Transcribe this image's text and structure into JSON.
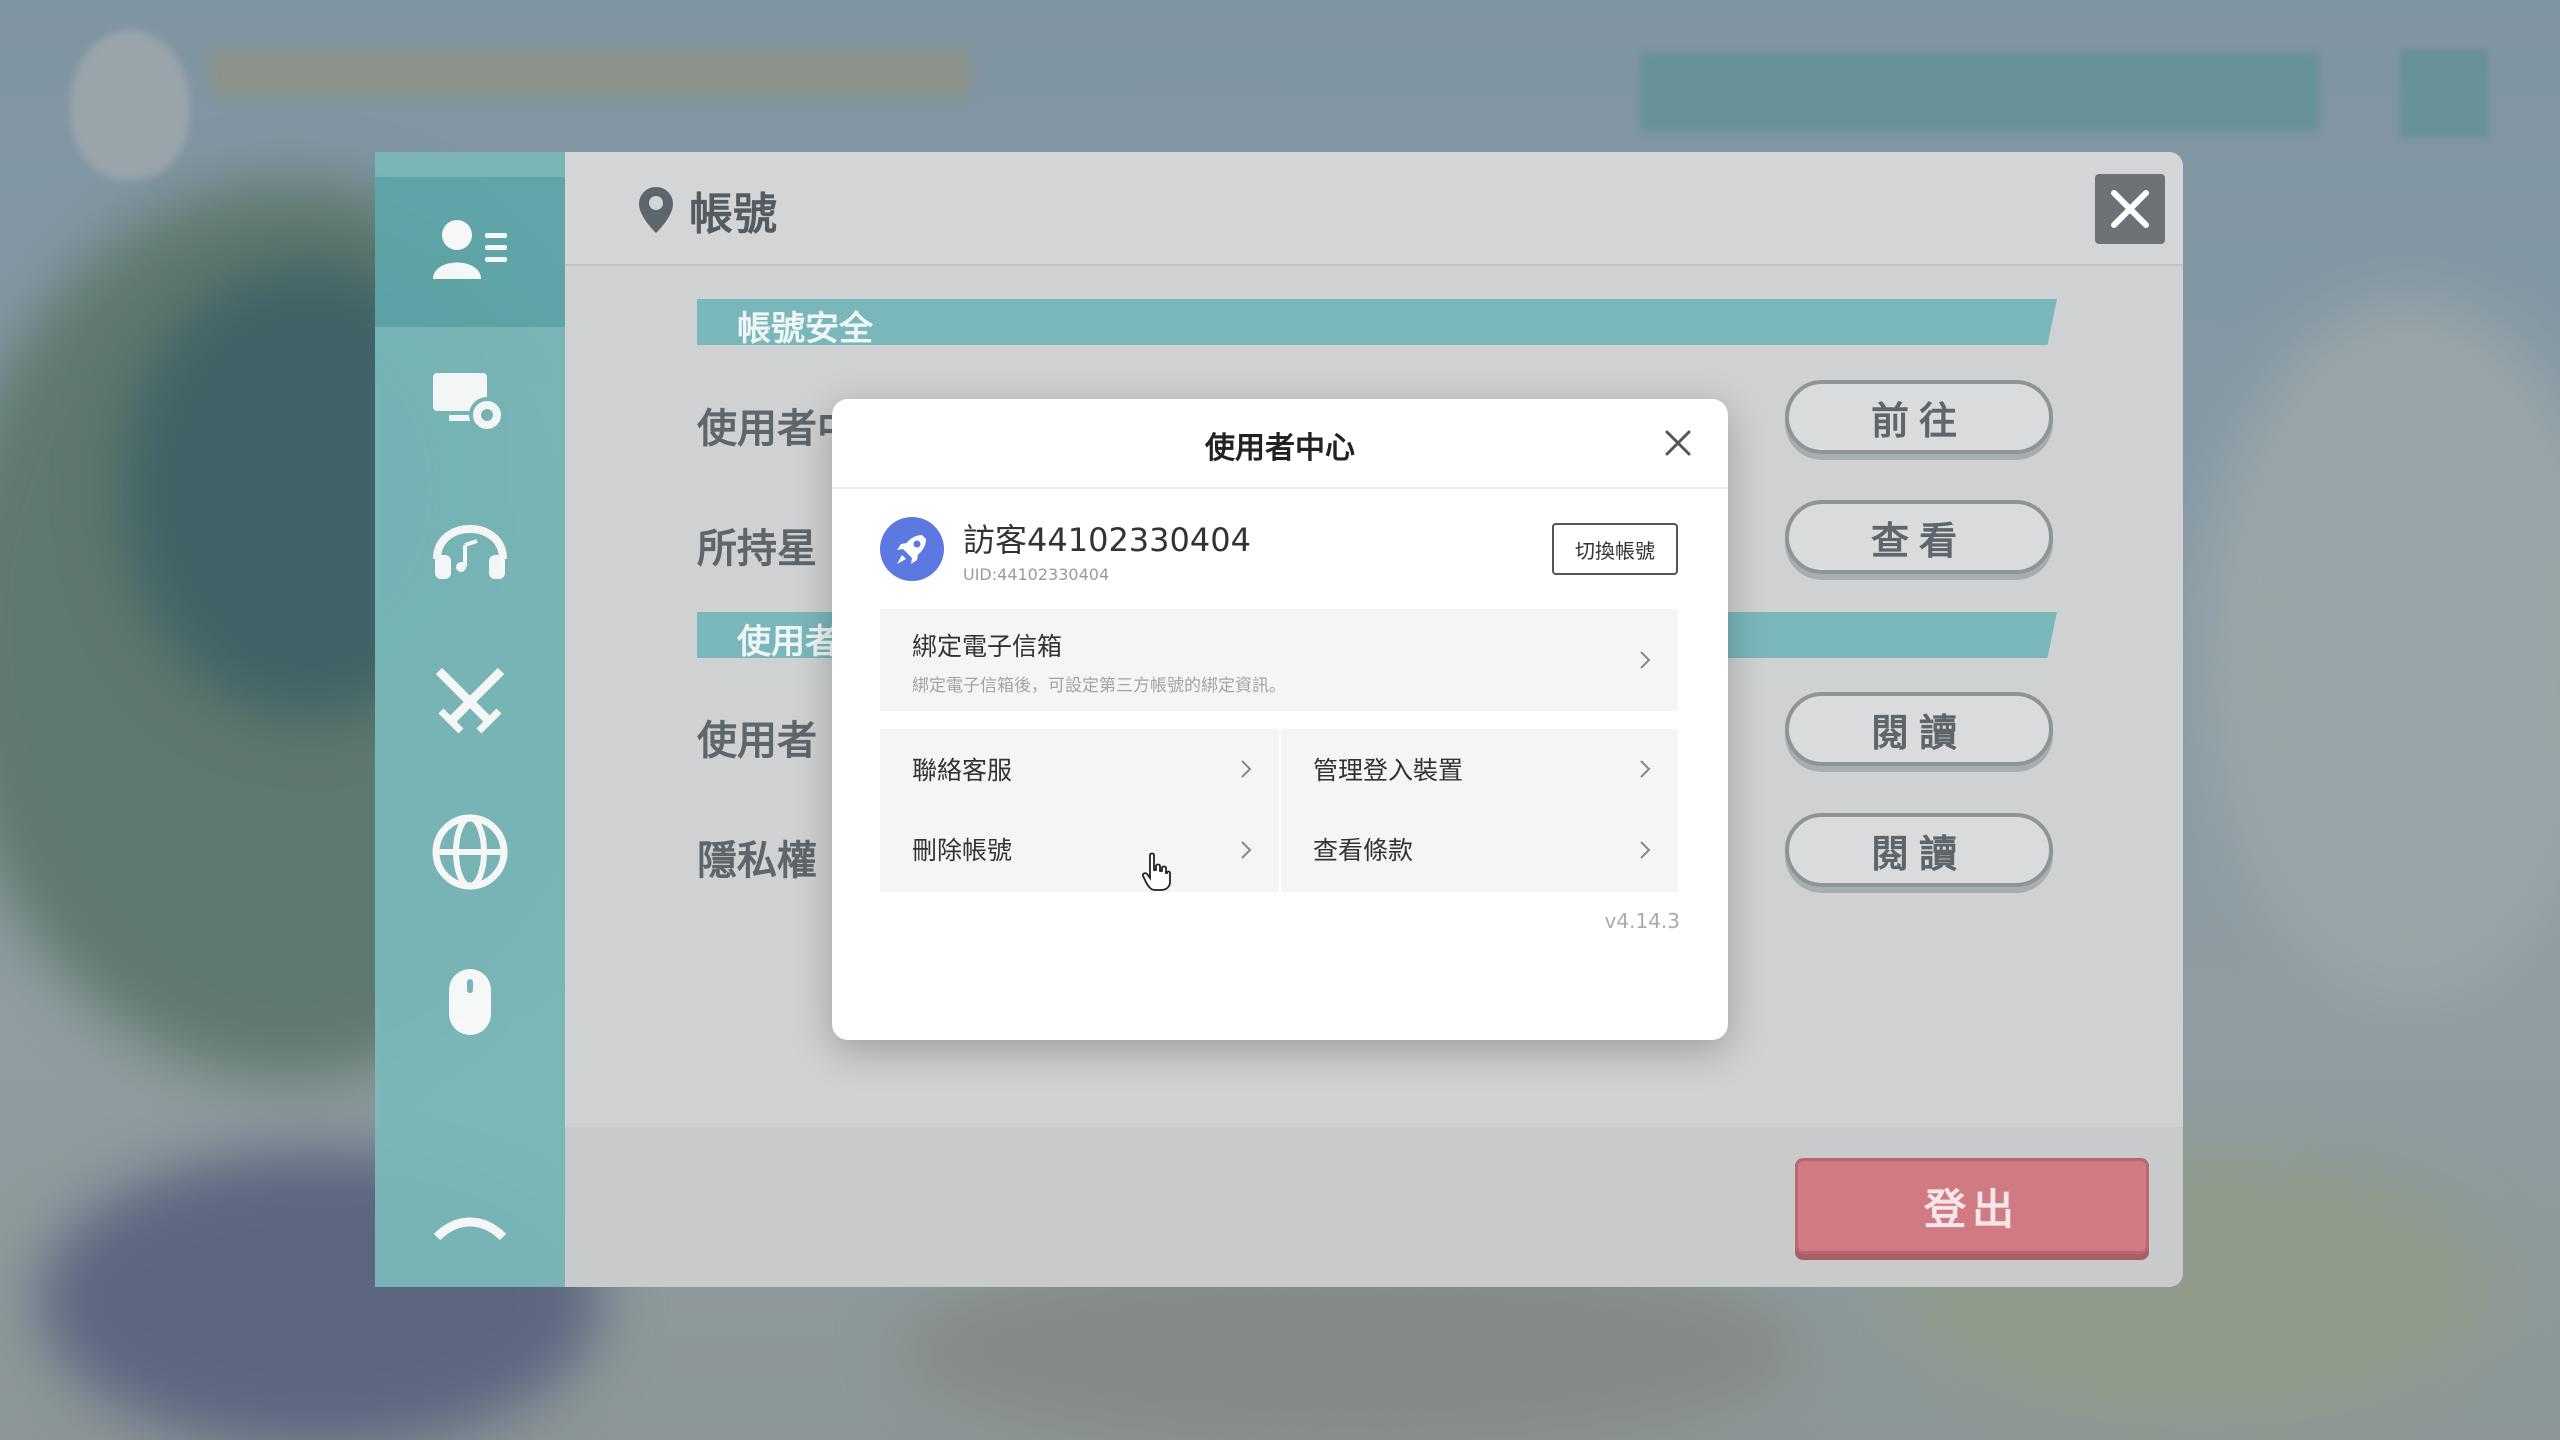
{
  "panel": {
    "title": "帳號",
    "sections": [
      {
        "banner": "帳號安全"
      },
      {
        "banner": "使用者"
      }
    ],
    "rows": [
      {
        "label": "使用者中",
        "button": "前往"
      },
      {
        "label": "所持星",
        "button": "查看"
      },
      {
        "label": "使用者",
        "button": "閱讀"
      },
      {
        "label": "隱私權",
        "button": "閱讀"
      }
    ],
    "logout_label": "登出"
  },
  "sidebar": {
    "items": [
      {
        "icon": "account-icon",
        "active": true
      },
      {
        "icon": "settings-monitor-icon"
      },
      {
        "icon": "headphones-icon"
      },
      {
        "icon": "crossed-swords-icon"
      },
      {
        "icon": "globe-icon"
      },
      {
        "icon": "mouse-icon"
      },
      {
        "icon": "more-icon"
      }
    ]
  },
  "user_center": {
    "title": "使用者中心",
    "username": "訪客44102330404",
    "uid": "UID:44102330404",
    "switch_account": "切換帳號",
    "bind_email": {
      "title": "綁定電子信箱",
      "description": "綁定電子信箱後，可設定第三方帳號的綁定資訊。"
    },
    "menu": {
      "contact_support": "聯絡客服",
      "manage_devices": "管理登入裝置",
      "delete_account": "刪除帳號",
      "view_terms": "查看條款"
    },
    "version": "v4.14.3"
  },
  "colors": {
    "accent_teal": "#7ab8ba",
    "logout_red": "#d07a83",
    "avatar_blue": "#5b79e0"
  }
}
